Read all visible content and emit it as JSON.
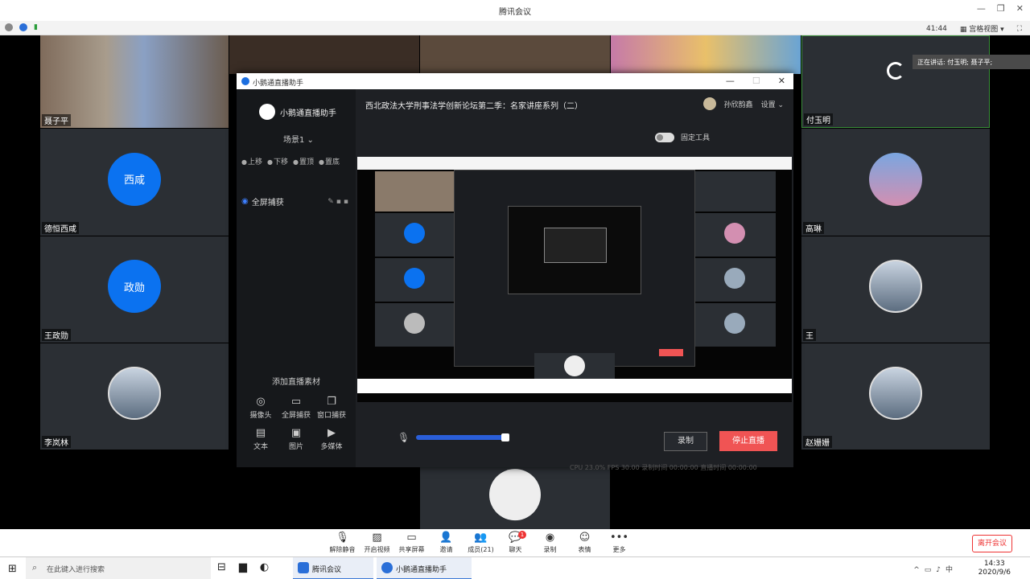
{
  "window": {
    "title": "腾讯会议"
  },
  "meeting_bar": {
    "timer": "41:44",
    "view_mode": "宫格视图"
  },
  "toast": "正在讲话: 付玉明; 聂子平;",
  "participants": [
    {
      "name": "聂子平",
      "avatar_text": ""
    },
    {
      "name": "付玉明",
      "avatar_text": ""
    },
    {
      "name": "德恒西咸",
      "avatar_text": "西咸"
    },
    {
      "name": "高琳",
      "avatar_text": ""
    },
    {
      "name": "王政勋",
      "avatar_text": "政勋"
    },
    {
      "name": "王",
      "avatar_text": ""
    },
    {
      "name": "李岚林",
      "avatar_text": ""
    },
    {
      "name": "赵姗姗",
      "avatar_text": ""
    }
  ],
  "live_window": {
    "title": "小鹅通直播助手",
    "app_name": "小鹅通直播助手",
    "scene": "场景1 ⌄",
    "ops": [
      "上移",
      "下移",
      "置顶",
      "置底"
    ],
    "capture_item": "全屏捕获",
    "add_material": "添加直播素材",
    "sources": [
      "摄像头",
      "全屏捕获",
      "窗口捕获",
      "文本",
      "图片",
      "多媒体"
    ],
    "stream_title": "西北政法大学刑事法学创新论坛第二季：名家讲座系列（二）",
    "user_name": "孙欣韵鑫",
    "settings": "设置 ⌄",
    "pin_tool": "固定工具",
    "record": "录制",
    "stop": "停止直播",
    "stats": "CPU  23.0%  FPS  30.00  录制时间  00:00:00  直播时间  00:00:00"
  },
  "bottom_toolbar": {
    "items": [
      "解除静音",
      "开启视频",
      "共享屏幕",
      "邀请",
      "成员(21)",
      "聊天",
      "录制",
      "表情",
      "更多"
    ],
    "chat_badge": "1",
    "leave": "离开会议"
  },
  "taskbar": {
    "search_placeholder": "在此键入进行搜索",
    "apps": [
      "腾讯会议",
      "小鹅通直播助手"
    ],
    "time": "14:33",
    "date": "2020/9/6"
  }
}
